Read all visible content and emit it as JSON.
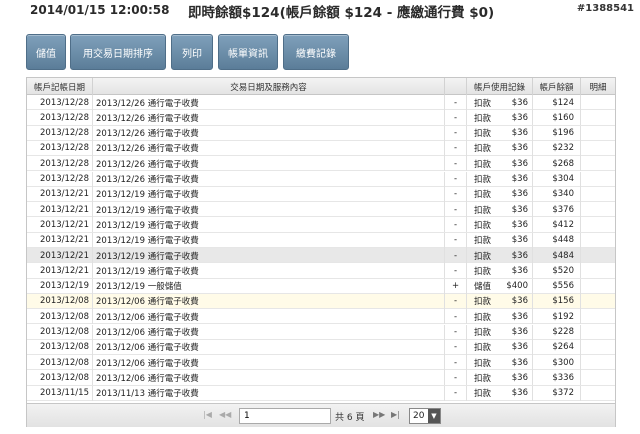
{
  "header": {
    "datetime": "2014/01/15 12:00:58",
    "title": "即時餘額$124(帳戶餘額 $124 - 應繳通行費 $0)",
    "id": "#1388541"
  },
  "toolbar": {
    "topup": "儲值",
    "sort_by_trade_date": "用交易日期排序",
    "print": "列印",
    "bill_info": "帳單資訊",
    "payment_records": "繳費記錄"
  },
  "table": {
    "columns": {
      "post_date": "帳戶記帳日期",
      "description": "交易日期及服務內容",
      "usage": "帳戶使用記錄",
      "balance": "帳戶餘額",
      "detail": "明細"
    },
    "rows": [
      {
        "post_date": "2013/12/28",
        "desc": "2013/12/26 通行電子收費",
        "sign": "-",
        "type": "扣款",
        "amount": "$36",
        "balance": "$124"
      },
      {
        "post_date": "2013/12/28",
        "desc": "2013/12/26 通行電子收費",
        "sign": "-",
        "type": "扣款",
        "amount": "$36",
        "balance": "$160"
      },
      {
        "post_date": "2013/12/28",
        "desc": "2013/12/26 通行電子收費",
        "sign": "-",
        "type": "扣款",
        "amount": "$36",
        "balance": "$196"
      },
      {
        "post_date": "2013/12/28",
        "desc": "2013/12/26 通行電子收費",
        "sign": "-",
        "type": "扣款",
        "amount": "$36",
        "balance": "$232"
      },
      {
        "post_date": "2013/12/28",
        "desc": "2013/12/26 通行電子收費",
        "sign": "-",
        "type": "扣款",
        "amount": "$36",
        "balance": "$268"
      },
      {
        "post_date": "2013/12/28",
        "desc": "2013/12/26 通行電子收費",
        "sign": "-",
        "type": "扣款",
        "amount": "$36",
        "balance": "$304"
      },
      {
        "post_date": "2013/12/21",
        "desc": "2013/12/19 通行電子收費",
        "sign": "-",
        "type": "扣款",
        "amount": "$36",
        "balance": "$340"
      },
      {
        "post_date": "2013/12/21",
        "desc": "2013/12/19 通行電子收費",
        "sign": "-",
        "type": "扣款",
        "amount": "$36",
        "balance": "$376"
      },
      {
        "post_date": "2013/12/21",
        "desc": "2013/12/19 通行電子收費",
        "sign": "-",
        "type": "扣款",
        "amount": "$36",
        "balance": "$412"
      },
      {
        "post_date": "2013/12/21",
        "desc": "2013/12/19 通行電子收費",
        "sign": "-",
        "type": "扣款",
        "amount": "$36",
        "balance": "$448"
      },
      {
        "post_date": "2013/12/21",
        "desc": "2013/12/19 通行電子收費",
        "sign": "-",
        "type": "扣款",
        "amount": "$36",
        "balance": "$484"
      },
      {
        "post_date": "2013/12/21",
        "desc": "2013/12/19 通行電子收費",
        "sign": "-",
        "type": "扣款",
        "amount": "$36",
        "balance": "$520"
      },
      {
        "post_date": "2013/12/19",
        "desc": "2013/12/19 一般儲值",
        "sign": "+",
        "type": "儲值",
        "amount": "$400",
        "balance": "$556"
      },
      {
        "post_date": "2013/12/08",
        "desc": "2013/12/06 通行電子收費",
        "sign": "-",
        "type": "扣款",
        "amount": "$36",
        "balance": "$156"
      },
      {
        "post_date": "2013/12/08",
        "desc": "2013/12/06 通行電子收費",
        "sign": "-",
        "type": "扣款",
        "amount": "$36",
        "balance": "$192"
      },
      {
        "post_date": "2013/12/08",
        "desc": "2013/12/06 通行電子收費",
        "sign": "-",
        "type": "扣款",
        "amount": "$36",
        "balance": "$228"
      },
      {
        "post_date": "2013/12/08",
        "desc": "2013/12/06 通行電子收費",
        "sign": "-",
        "type": "扣款",
        "amount": "$36",
        "balance": "$264"
      },
      {
        "post_date": "2013/12/08",
        "desc": "2013/12/06 通行電子收費",
        "sign": "-",
        "type": "扣款",
        "amount": "$36",
        "balance": "$300"
      },
      {
        "post_date": "2013/12/08",
        "desc": "2013/12/06 通行電子收費",
        "sign": "-",
        "type": "扣款",
        "amount": "$36",
        "balance": "$336"
      },
      {
        "post_date": "2013/11/15",
        "desc": "2013/11/13 通行電子收費",
        "sign": "-",
        "type": "扣款",
        "amount": "$36",
        "balance": "$372"
      }
    ],
    "highlighted_row": 10,
    "selected_row": 13
  },
  "pager": {
    "first_icon": "first-page-icon",
    "prev_icon": "prev-page-icon",
    "next_icon": "next-page-icon",
    "last_icon": "last-page-icon",
    "page_value": "1",
    "total_text": "共 6 頁",
    "page_size": "20"
  }
}
